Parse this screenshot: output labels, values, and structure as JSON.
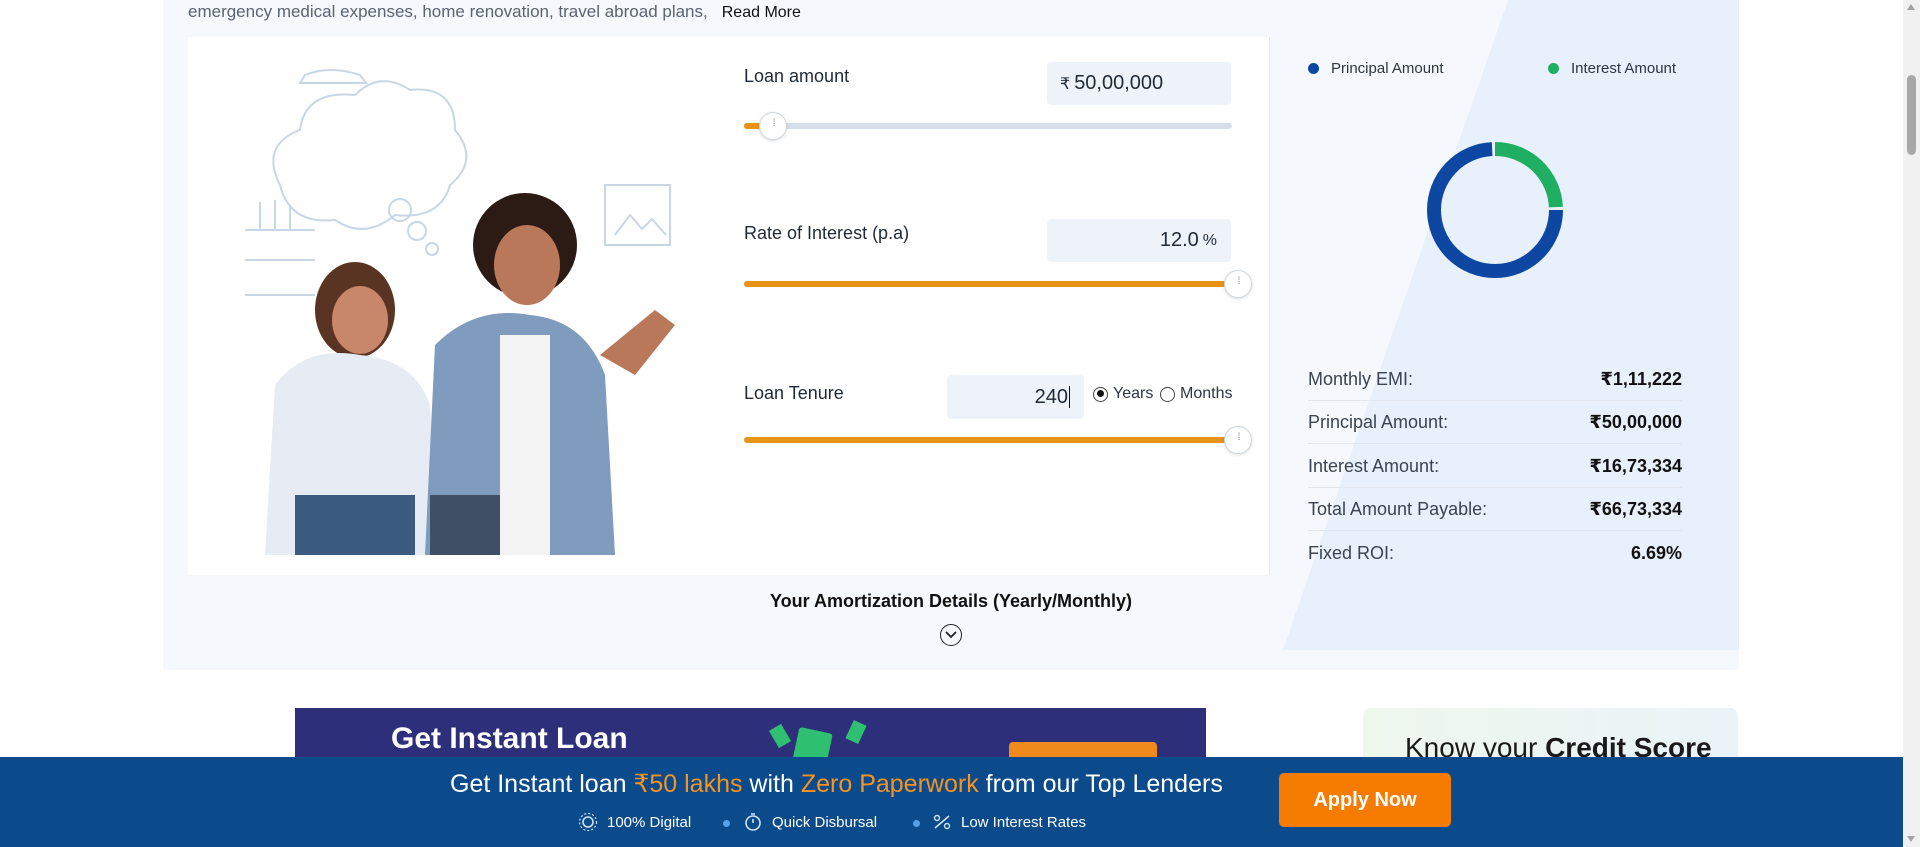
{
  "intro": {
    "text": "emergency medical expenses, home renovation, travel abroad plans,",
    "read_more": "Read More"
  },
  "calculator": {
    "loan_amount": {
      "label": "Loan amount",
      "currency": "₹",
      "value": "50,00,000",
      "slider_fill_fraction": 0.06
    },
    "interest_rate": {
      "label": "Rate of Interest (p.a)",
      "value": "12.0",
      "unit": "%",
      "slider_fill_fraction": 1.0
    },
    "tenure": {
      "label": "Loan Tenure",
      "value": "240",
      "slider_fill_fraction": 1.0,
      "options": [
        {
          "label": "Years",
          "selected": true
        },
        {
          "label": "Months",
          "selected": false
        }
      ]
    }
  },
  "breakdown": {
    "legend": [
      {
        "label": "Principal Amount",
        "color": "#0d47a1"
      },
      {
        "label": "Interest Amount",
        "color": "#1fae62"
      }
    ],
    "donut_fractions": {
      "principal": 0.75,
      "interest": 0.25
    },
    "rows": [
      {
        "key": "Monthly EMI:",
        "value": "₹1,11,222"
      },
      {
        "key": "Principal Amount:",
        "value": "₹50,00,000"
      },
      {
        "key": "Interest Amount:",
        "value": "₹16,73,334"
      },
      {
        "key": "Total Amount Payable:",
        "value": "₹66,73,334"
      },
      {
        "key": "Fixed ROI:",
        "value": "6.69%"
      }
    ]
  },
  "amortization": {
    "title": "Your Amortization Details (Yearly/Monthly)",
    "toggle_icon": "chevron-down-circle-icon"
  },
  "ad_banner": {
    "title": "Get Instant Loan"
  },
  "credit_card": {
    "prefix": "Know your ",
    "bold": "Credit Score"
  },
  "sticky_bar": {
    "headline_parts": {
      "p1": "Get Instant loan ",
      "h1": "₹50 lakhs",
      "p2": " with ",
      "h2": "Zero Paperwork",
      "p3": " from our Top Lenders"
    },
    "features": [
      "100% Digital",
      "Quick Disbursal",
      "Low Interest Rates"
    ],
    "apply_label": "Apply Now",
    "accent_color": "#f7931e",
    "background_color": "#0b4a8b"
  }
}
